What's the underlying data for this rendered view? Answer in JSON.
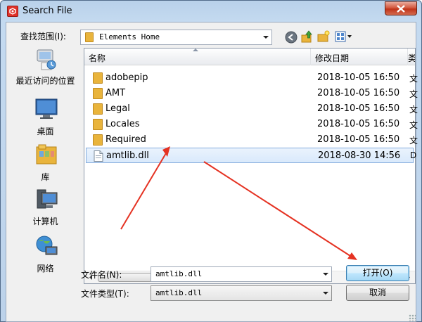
{
  "window": {
    "title": "Search File"
  },
  "lookin": {
    "label": "查找范围(I):",
    "value": "Elements Home"
  },
  "places": [
    {
      "label": "最近访问的位置",
      "icon": "recent-places-icon"
    },
    {
      "label": "桌面",
      "icon": "desktop-icon"
    },
    {
      "label": "库",
      "icon": "libraries-icon"
    },
    {
      "label": "计算机",
      "icon": "computer-icon"
    },
    {
      "label": "网络",
      "icon": "network-icon"
    }
  ],
  "columns": {
    "name": "名称",
    "date": "修改日期",
    "type": "类"
  },
  "files": [
    {
      "name": "adobepip",
      "date": "2018-10-05 16:50",
      "type": "文",
      "kind": "folder"
    },
    {
      "name": "AMT",
      "date": "2018-10-05 16:50",
      "type": "文",
      "kind": "folder"
    },
    {
      "name": "Legal",
      "date": "2018-10-05 16:50",
      "type": "文",
      "kind": "folder"
    },
    {
      "name": "Locales",
      "date": "2018-10-05 16:50",
      "type": "文",
      "kind": "folder"
    },
    {
      "name": "Required",
      "date": "2018-10-05 16:50",
      "type": "文",
      "kind": "folder"
    },
    {
      "name": "amtlib.dll",
      "date": "2018-08-30 14:56",
      "type": "D",
      "kind": "file",
      "selected": true
    }
  ],
  "filename": {
    "label": "文件名(N):",
    "value": "amtlib.dll"
  },
  "filetype": {
    "label": "文件类型(T):",
    "value": "amtlib.dll"
  },
  "buttons": {
    "open": "打开(O)",
    "cancel": "取消"
  },
  "colors": {
    "accent": "#3c7fb1",
    "selection": "#d9e9fb",
    "annotation": "#e53222"
  }
}
